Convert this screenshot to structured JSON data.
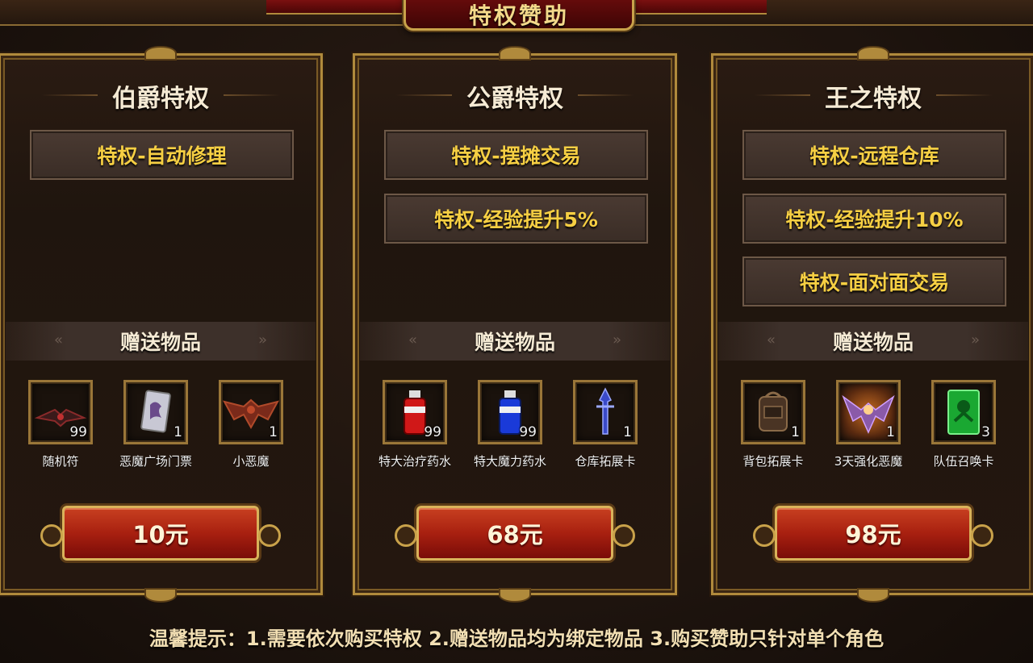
{
  "header": {
    "title": "特权赞助"
  },
  "tiers": [
    {
      "title": "伯爵特权",
      "perks": [
        "特权-自动修理"
      ],
      "gift_label": "赠送物品",
      "items": [
        {
          "name": "随机符",
          "qty": "99",
          "icon": "bat-wing-charm-icon"
        },
        {
          "name": "恶魔广场门票",
          "qty": "1",
          "icon": "demon-ticket-icon"
        },
        {
          "name": "小恶魔",
          "qty": "1",
          "icon": "imp-icon"
        }
      ],
      "price": "10元"
    },
    {
      "title": "公爵特权",
      "perks": [
        "特权-摆摊交易",
        "特权-经验提升5%"
      ],
      "gift_label": "赠送物品",
      "items": [
        {
          "name": "特大治疗药水",
          "qty": "99",
          "icon": "red-potion-icon"
        },
        {
          "name": "特大魔力药水",
          "qty": "99",
          "icon": "blue-potion-icon"
        },
        {
          "name": "仓库拓展卡",
          "qty": "1",
          "icon": "warehouse-card-icon"
        }
      ],
      "price": "68元"
    },
    {
      "title": "王之特权",
      "perks": [
        "特权-远程仓库",
        "特权-经验提升10%",
        "特权-面对面交易"
      ],
      "gift_label": "赠送物品",
      "items": [
        {
          "name": "背包拓展卡",
          "qty": "1",
          "icon": "backpack-icon"
        },
        {
          "name": "3天强化恶魔",
          "qty": "1",
          "icon": "winged-demon-icon"
        },
        {
          "name": "队伍召唤卡",
          "qty": "3",
          "icon": "summon-card-icon"
        }
      ],
      "price": "98元"
    }
  ],
  "footer": {
    "tip": "温馨提示：1.需要依次购买特权 2.赠送物品均为绑定物品 3.购买赞助只针对单个角色"
  },
  "colors": {
    "perk_text": "#f6cf43",
    "button_red": "#a82010",
    "gold_border": "#b08a3c"
  }
}
